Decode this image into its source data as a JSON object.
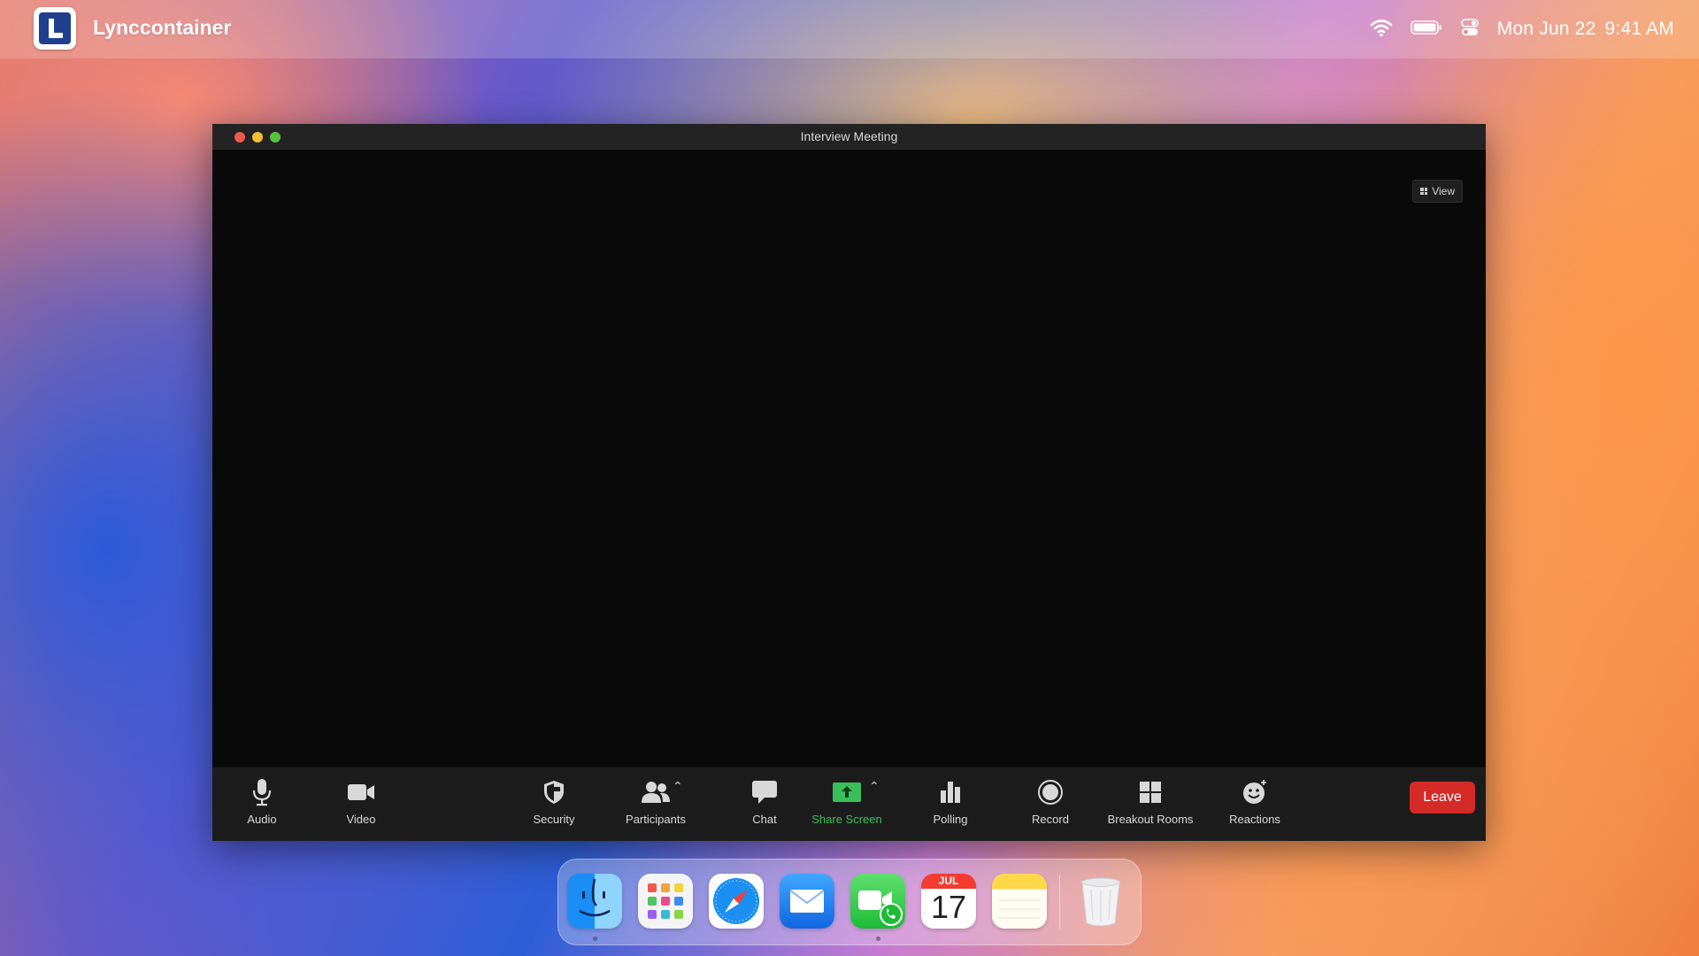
{
  "menubar": {
    "app_name": "Lynccontainer",
    "date": "Mon Jun 22",
    "time": "9:41 AM",
    "icons": [
      "wifi-icon",
      "battery-icon",
      "control-center-icon"
    ]
  },
  "window": {
    "title": "Interview Meeting",
    "view_label": "View"
  },
  "toolbar": {
    "audio": "Audio",
    "video": "Video",
    "security": "Security",
    "participants": "Participants",
    "chat": "Chat",
    "share_screen": "Share Screen",
    "polling": "Polling",
    "record": "Record",
    "breakout_rooms": "Breakout Rooms",
    "reactions": "Reactions",
    "leave": "Leave"
  },
  "dock": {
    "apps": [
      "finder",
      "launchpad",
      "safari",
      "mail",
      "facetime",
      "calendar",
      "notes",
      "trash"
    ],
    "calendar_month": "JUL",
    "calendar_day": "17"
  },
  "colors": {
    "share_green": "#39c05a",
    "leave_red": "#d52b28",
    "toolbar_bg": "#1c1c1c",
    "meeting_bg": "#0a0a0a"
  }
}
